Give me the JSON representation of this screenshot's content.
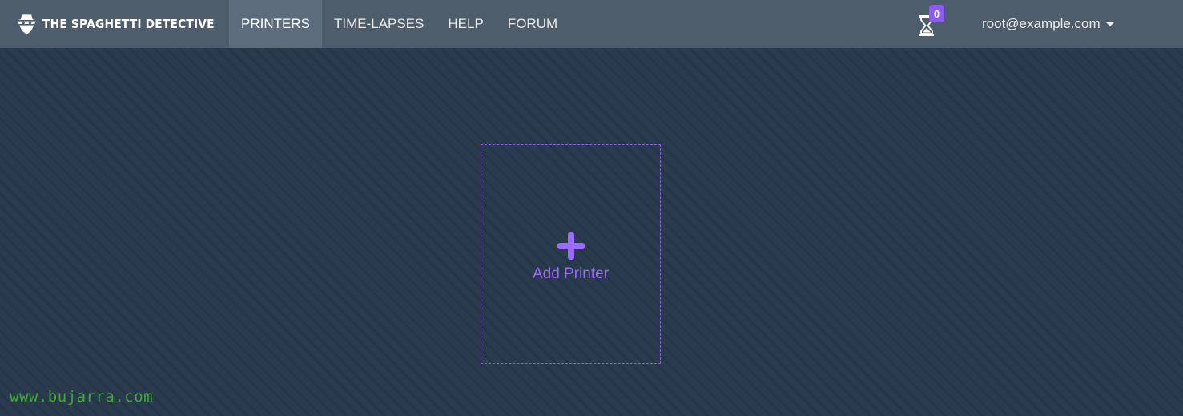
{
  "brand": {
    "name": "THE SPAGHETTI DETECTIVE",
    "icon": "detective-logo-icon"
  },
  "nav": {
    "items": [
      {
        "label": "PRINTERS",
        "active": true
      },
      {
        "label": "TIME-LAPSES",
        "active": false
      },
      {
        "label": "HELP",
        "active": false
      },
      {
        "label": "FORUM",
        "active": false
      }
    ]
  },
  "queue": {
    "icon": "hourglass-icon",
    "count": "0"
  },
  "user": {
    "email": "root@example.com"
  },
  "main": {
    "add_printer_label": "Add Printer",
    "add_icon": "plus-icon"
  },
  "watermark": "www.bujarra.com",
  "colors": {
    "accent": "#8c5cf0",
    "navbar": "#4e5d6c",
    "background": "#2b3b4e"
  }
}
